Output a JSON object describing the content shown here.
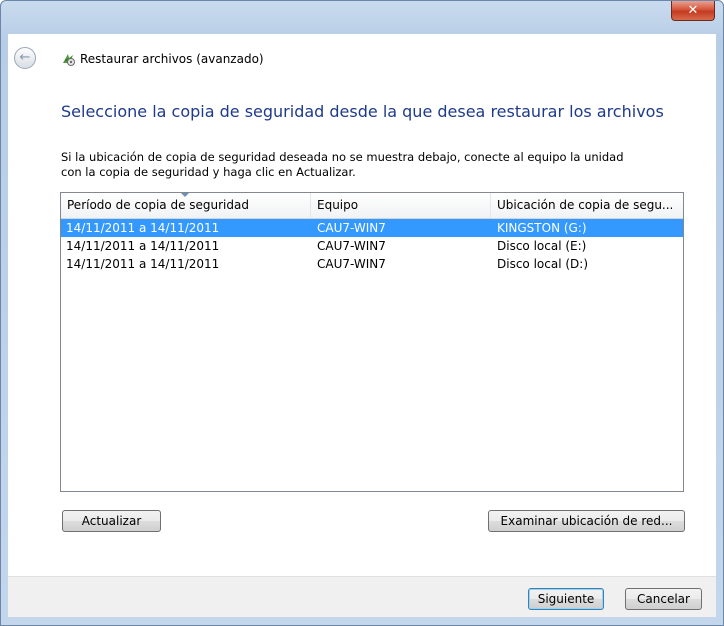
{
  "window": {
    "close_glyph": "✕"
  },
  "header": {
    "back_icon": "back-arrow-icon",
    "title": "Restaurar archivos (avanzado)"
  },
  "main": {
    "heading": "Seleccione la copia de seguridad desde la que desea restaurar los archivos",
    "instruction_line1": "Si la ubicación de copia de seguridad deseada no se muestra debajo, conecte al equipo la unidad",
    "instruction_line2": "con la copia de seguridad y haga clic en Actualizar."
  },
  "table": {
    "columns": [
      "Período de copia de seguridad",
      "Equipo",
      "Ubicación de copia de segu..."
    ],
    "rows": [
      [
        "14/11/2011 a 14/11/2011",
        "CAU7-WIN7",
        "KINGSTON (G:)"
      ],
      [
        "14/11/2011 a 14/11/2011",
        "CAU7-WIN7",
        "Disco local (E:)"
      ],
      [
        "14/11/2011 a 14/11/2011",
        "CAU7-WIN7",
        "Disco local (D:)"
      ]
    ],
    "selected_row": 0
  },
  "buttons": {
    "refresh": "Actualizar",
    "browse": "Examinar ubicación de red...",
    "next": "Siguiente",
    "cancel": "Cancelar"
  },
  "colors": {
    "heading": "#1e3a8a",
    "selection": "#3399ff"
  }
}
